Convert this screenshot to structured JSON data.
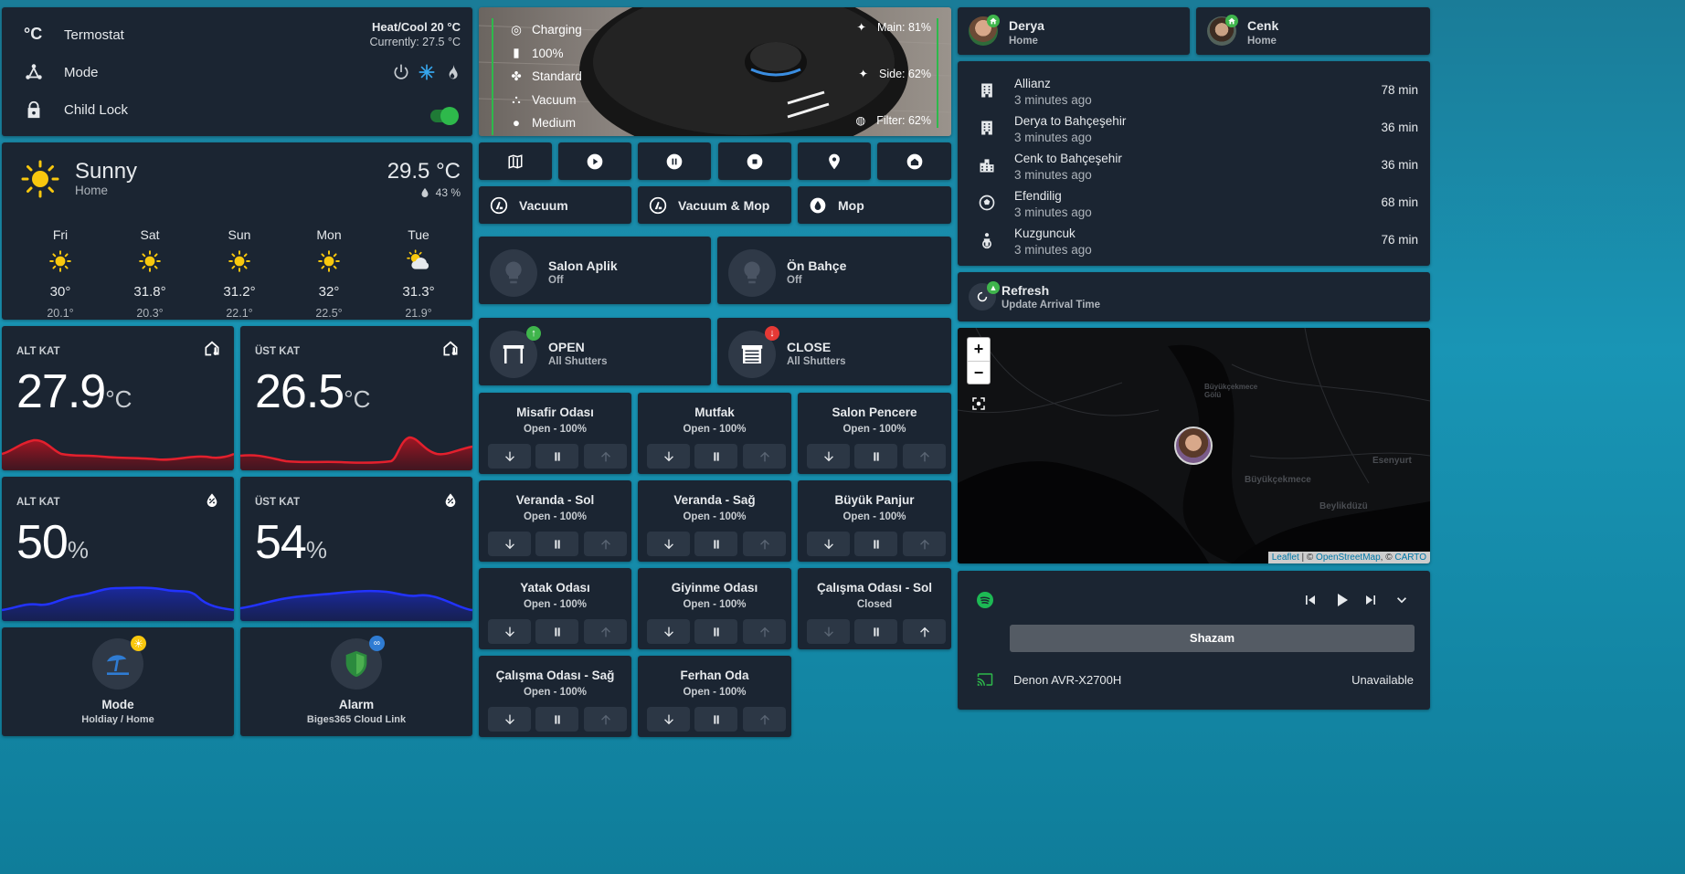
{
  "thermostat": {
    "name": "Termostat",
    "mode_label": "Mode",
    "child_lock_label": "Child Lock",
    "state": "Heat/Cool 20 °C",
    "current": "Currently: 27.5 °C",
    "child_lock_on": true,
    "accent": "#2eb94b"
  },
  "weather": {
    "condition": "Sunny",
    "location": "Home",
    "temperature": "29.5 °C",
    "humidity": "43 %",
    "forecast": [
      {
        "day": "Fri",
        "high": "30°",
        "low": "20.1°",
        "icon": "sun-icon"
      },
      {
        "day": "Sat",
        "high": "31.8°",
        "low": "20.3°",
        "icon": "sun-icon"
      },
      {
        "day": "Sun",
        "high": "31.2°",
        "low": "22.1°",
        "icon": "sun-icon"
      },
      {
        "day": "Mon",
        "high": "32°",
        "low": "22.5°",
        "icon": "sun-icon"
      },
      {
        "day": "Tue",
        "high": "31.3°",
        "low": "21.9°",
        "icon": "partly-cloudy-icon"
      }
    ]
  },
  "sensors": {
    "alt_temp": {
      "title": "ALT KAT",
      "value": "27.9",
      "unit": "°C",
      "icon": "home-thermometer-icon",
      "color": "#d81b2a"
    },
    "ust_temp": {
      "title": "ÜST KAT",
      "value": "26.5",
      "unit": "°C",
      "icon": "home-thermometer-icon",
      "color": "#d81b2a"
    },
    "alt_hum": {
      "title": "ALT KAT",
      "value": "50",
      "unit": "%",
      "icon": "water-percent-icon",
      "color": "#1f2ee0"
    },
    "ust_hum": {
      "title": "ÜST KAT",
      "value": "54",
      "unit": "%",
      "icon": "water-percent-icon",
      "color": "#1f2ee0"
    }
  },
  "mode_card": {
    "title": "Mode",
    "state": "Holdiay / Home"
  },
  "alarm_card": {
    "title": "Alarm",
    "state": "Biges365 Cloud Link"
  },
  "vacuum": {
    "status": [
      "Charging",
      "100%",
      "Standard",
      "Vacuum",
      "Medium"
    ],
    "main": "Main: 81%",
    "side": "Side: 62%",
    "filter": "Filter: 62%",
    "controls": [
      "map-icon",
      "play-icon",
      "pause-icon",
      "stop-icon",
      "locate-icon",
      "home-icon"
    ],
    "modes": [
      "Vacuum",
      "Vacuum & Mop",
      "Mop"
    ]
  },
  "lights": [
    {
      "name": "Salon Aplik",
      "state": "Off"
    },
    {
      "name": "Ön Bahçe",
      "state": "Off"
    }
  ],
  "shutter_groups": [
    {
      "name": "OPEN",
      "sub": "All Shutters",
      "badge_color": "#2eb94b"
    },
    {
      "name": "CLOSE",
      "sub": "All Shutters",
      "badge_color": "#e53935"
    }
  ],
  "shutters": [
    {
      "name": "Misafir Odası",
      "state": "Open - 100%"
    },
    {
      "name": "Mutfak",
      "state": "Open - 100%"
    },
    {
      "name": "Salon Pencere",
      "state": "Open - 100%"
    },
    {
      "name": "Veranda - Sol",
      "state": "Open - 100%"
    },
    {
      "name": "Veranda - Sağ",
      "state": "Open - 100%"
    },
    {
      "name": "Büyük Panjur",
      "state": "Open - 100%"
    },
    {
      "name": "Yatak Odası",
      "state": "Open - 100%"
    },
    {
      "name": "Giyinme Odası",
      "state": "Open - 100%"
    },
    {
      "name": "Çalışma Odası - Sol",
      "state": "Closed"
    },
    {
      "name": "Çalışma Odası - Sağ",
      "state": "Open - 100%"
    },
    {
      "name": "Ferhan Oda",
      "state": "Open - 100%"
    }
  ],
  "people": [
    {
      "name": "Derya",
      "state": "Home"
    },
    {
      "name": "Cenk",
      "state": "Home"
    }
  ],
  "travel": [
    {
      "name": "Allianz",
      "ago": "3 minutes ago",
      "time": "78 min",
      "icon": "office-building-icon"
    },
    {
      "name": "Derya to Bahçeşehir",
      "ago": "3 minutes ago",
      "time": "36 min",
      "icon": "office-building-icon"
    },
    {
      "name": "Cenk to Bahçeşehir",
      "ago": "3 minutes ago",
      "time": "36 min",
      "icon": "city-icon"
    },
    {
      "name": "Efendilig",
      "ago": "3 minutes ago",
      "time": "68 min",
      "icon": "soccer-icon"
    },
    {
      "name": "Kuzguncuk",
      "ago": "3 minutes ago",
      "time": "76 min",
      "icon": "human-child-icon"
    }
  ],
  "refresh": {
    "title": "Refresh",
    "sub": "Update Arrival Time"
  },
  "map": {
    "zoom_in": "+",
    "zoom_out": "−",
    "labels": [
      "Büyükçekmece Gölü",
      "Esenyurt",
      "Büyükçekmece",
      "Beylikdüzü"
    ],
    "attribution_leaflet": "Leaflet",
    "attribution_osm": "OpenStreetMap",
    "attribution_carto": "CARTO",
    "attribution_sep1": " | © ",
    "attribution_sep2": ", © "
  },
  "media": {
    "source_button": "Shazam",
    "device": "Denon AVR-X2700H",
    "device_state": "Unavailable",
    "spotify_color": "#1db954"
  }
}
